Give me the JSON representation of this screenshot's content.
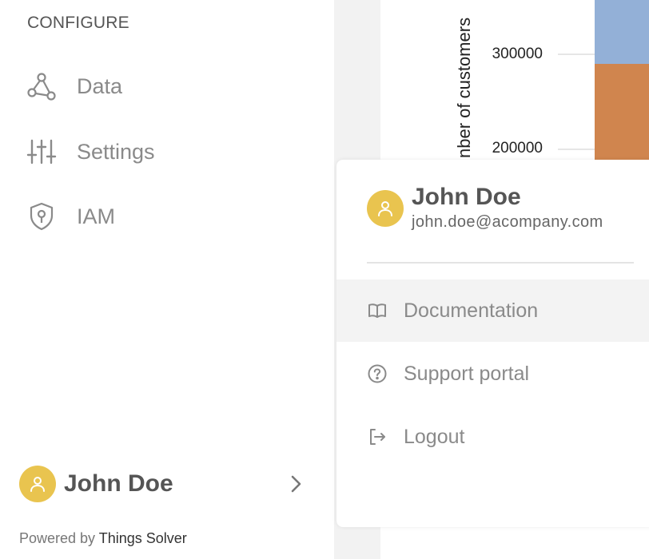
{
  "chart_data": {
    "type": "bar",
    "ylabel": "Number of customers",
    "ylabel_visible": "nber of customers",
    "y_ticks": [
      200000,
      300000
    ],
    "y_tick_labels": [
      "200000",
      "300000"
    ],
    "series_colors": [
      "#d0854e",
      "#93b0d7"
    ]
  },
  "sidebar": {
    "section_title": "CONFIGURE",
    "items": [
      {
        "label": "Data",
        "icon": "data-network-icon"
      },
      {
        "label": "Settings",
        "icon": "sliders-icon"
      },
      {
        "label": "IAM",
        "icon": "shield-key-icon"
      }
    ],
    "user_name": "John Doe",
    "powered_prefix": "Powered by",
    "powered_brand": "Things Solver"
  },
  "user_menu": {
    "name": "John Doe",
    "email": "john.doe@acompany.com",
    "items": [
      {
        "label": "Documentation",
        "icon": "book-icon"
      },
      {
        "label": "Support portal",
        "icon": "help-circle-icon"
      },
      {
        "label": "Logout",
        "icon": "logout-icon"
      }
    ]
  },
  "colors": {
    "avatar": "#e9c44f",
    "text_primary": "#555555",
    "text_muted": "#8a8a8a"
  }
}
